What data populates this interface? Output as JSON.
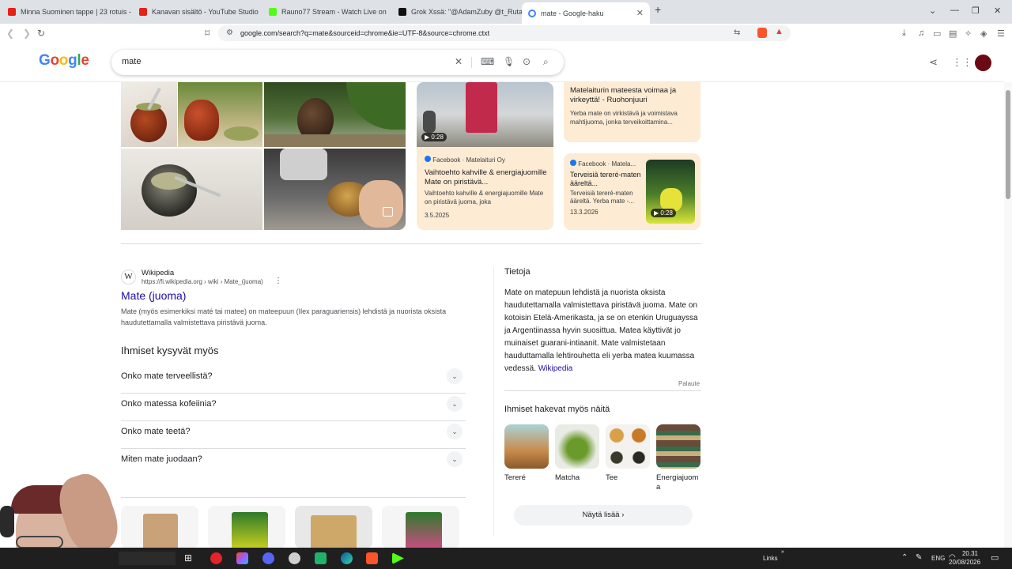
{
  "tabs": [
    {
      "title": "Minna Suominen tappe | 23 rotuis - H",
      "color": "#e62117"
    },
    {
      "title": "Kanavan sisältö - YouTube Studio",
      "color": "#e62117"
    },
    {
      "title": "Rauno77 Stream - Watch Live on",
      "color": "#53fc18"
    },
    {
      "title": "Grok Xssä: \"@AdamZuby @t_Ruta",
      "color": "#111111"
    },
    {
      "title": "mate - Google-haku",
      "color": "#4285f4"
    }
  ],
  "address": {
    "url": "google.com/search?q=mate&sourceid=chrome&ie=UTF-8&source=chrome.ctxt"
  },
  "google": {
    "logo": [
      "G",
      "o",
      "o",
      "g",
      "l",
      "e"
    ],
    "query": "mate"
  },
  "video_card": {
    "duration": "0:28",
    "source": "Facebook · Matelaituri Oy",
    "title": "Vaihtoehto kahville & energiajuomille Mate on piristävä...",
    "snippet": "Vaihtoehto kahville & energiajuomille Mate on piristävä juoma, joka",
    "date": "3.5.2025"
  },
  "text_card_top": {
    "title": "Matelaiturin mateesta voimaa ja virkeyttä! - Ruohonjuuri",
    "snippet": "Yerba mate on virkistävä ja voimistava mahtijuoma, jonka terveikoittamina..."
  },
  "video_card2": {
    "source": "Facebook · Matela...",
    "title": "Terveisiä tereré-maten ääreltä...",
    "snippet": "Terveisiä tereré-maten ääreltä. Yerba mate -...",
    "date": "13.3.2026",
    "duration": "0:28"
  },
  "result": {
    "site": "Wikipedia",
    "url": "https://fi.wikipedia.org › wiki › Mate_(juoma)",
    "title": "Mate (juoma)",
    "snippet": "Mate (myös esimerkiksi maté tai matee) on mateepuun (Ilex paraguariensis) lehdistä ja nuorista oksista haudutettamalla valmistettava piristävä juoma."
  },
  "paa": {
    "heading": "Ihmiset kysyvät myös",
    "questions": [
      "Onko mate terveellistä?",
      "Onko matessa kofeiinia?",
      "Onko mate teetä?",
      "Miten mate juodaan?"
    ]
  },
  "knowledge": {
    "heading": "Tietoja",
    "body": "Mate on matepuun lehdistä ja nuorista oksista haudutettamalla valmistettava piristävä juoma. Mate on kotoisin Etelä-Amerikasta, ja se on etenkin Uruguayssa ja Argentiinassa hyvin suosittua. Matea käyttivät jo muinaiset guarani-intiaanit. Mate valmistetaan hauduttamalla lehtirouhetta eli yerba matea kuumassa vedessä.",
    "source": "Wikipedia",
    "feedback": "Palaute",
    "people_heading": "Ihmiset hakevat myös näitä",
    "people": [
      "Tereré",
      "Matcha",
      "Tee",
      "Energiajuoma"
    ],
    "more": "Näytä lisää"
  },
  "taskbar": {
    "links": "Links",
    "lang": "ENG",
    "time": "20.31",
    "date": "20/08/2026"
  }
}
